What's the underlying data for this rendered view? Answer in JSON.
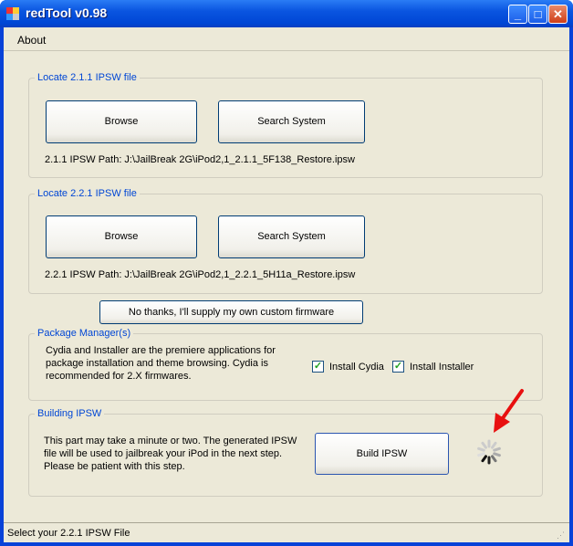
{
  "window": {
    "title": "redTool v0.98",
    "controls": [
      "minimize",
      "maximize",
      "close"
    ]
  },
  "menu": {
    "about": "About"
  },
  "group1": {
    "title": "Locate 2.1.1 IPSW file",
    "browse": "Browse",
    "search": "Search System",
    "path": "2.1.1 IPSW Path: J:\\JailBreak 2G\\iPod2,1_2.1.1_5F138_Restore.ipsw"
  },
  "group2": {
    "title": "Locate 2.2.1 IPSW file",
    "browse": "Browse",
    "search": "Search System",
    "path": "2.2.1 IPSW Path: J:\\JailBreak 2G\\iPod2,1_2.2.1_5H11a_Restore.ipsw"
  },
  "custom_button": "No thanks, I'll supply my own custom firmware",
  "packages": {
    "title": "Package Manager(s)",
    "lines": [
      "Cydia and Installer are the premiere applications for",
      "package installation and theme browsing. Cydia is",
      "recommended for 2.X firmwares."
    ],
    "cydia": {
      "label": "Install Cydia",
      "checked": true
    },
    "installer": {
      "label": "Install Installer",
      "checked": true
    }
  },
  "building": {
    "title": "Building IPSW",
    "lines": [
      "This part may take a minute or two. The generated IPSW",
      "file will be used to jailbreak your iPod in the next step.",
      "Please be patient with this step."
    ],
    "build": "Build IPSW"
  },
  "status": "Select your 2.2.1 IPSW File",
  "colors": {
    "titlebar": "#0a55e0",
    "accent": "#0046d5",
    "annotation_arrow": "#e81010"
  }
}
